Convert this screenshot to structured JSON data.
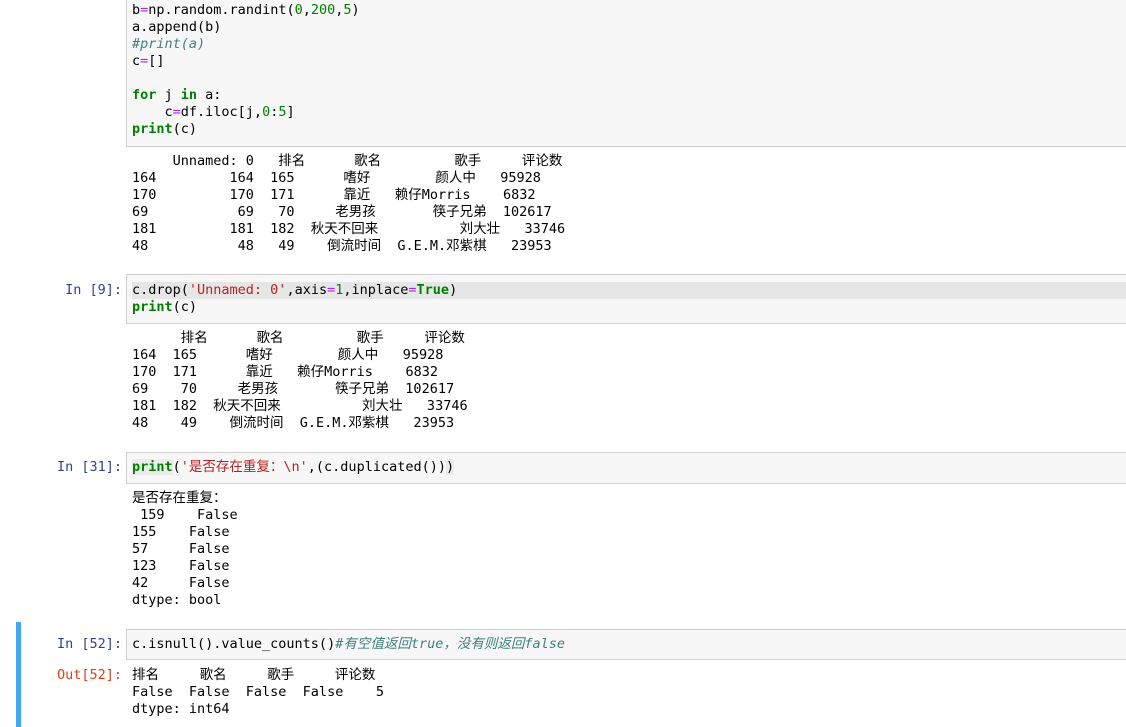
{
  "cells": [
    {
      "prompt": "",
      "code_lines": [
        "b=np.random.randint(0,200,5)",
        "a.append(b)",
        "#print(a)",
        "c=[]",
        "",
        "for j in a:",
        "    c=df.iloc[j,0:5]",
        "print(c)"
      ],
      "output": "     Unnamed: 0   排名      歌名         歌手     评论数\n164         164  165      嗜好        颜人中   95928\n170         170  171      靠近   赖仔Morris    6832\n69           69   70     老男孩       筷子兄弟  102617\n181         181  182  秋天不回来          刘大壮   33746\n48           48   49    倒流时间  G.E.M.邓紫棋   23953"
    },
    {
      "prompt": "In  [9]:",
      "code_lines": [
        "c.drop('Unnamed: 0',axis=1,inplace=True)",
        "print(c)"
      ],
      "output": "      排名      歌名         歌手     评论数\n164  165      嗜好        颜人中   95928\n170  171      靠近   赖仔Morris    6832\n69    70     老男孩       筷子兄弟  102617\n181  182  秋天不回来          刘大壮   33746\n48    49    倒流时间  G.E.M.邓紫棋   23953"
    },
    {
      "prompt": "In  [31]:",
      "code_lines": [
        "print('是否存在重复：\\n',(c.duplicated()))"
      ],
      "output": "是否存在重复：\n 159    False\n155    False\n57     False\n123    False\n42     False\ndtype: bool"
    },
    {
      "prompt": "In  [52]:",
      "out_prompt": "Out[52]:",
      "code_lines": [
        "c.isnull().value_counts()#有空值返回true，没有则返回false"
      ],
      "output": "排名     歌名     歌手     评论数\nFalse  False  False  False    5\ndtype: int64"
    }
  ],
  "colors": {
    "in_prompt": "#303f9f",
    "out_prompt": "#d84315",
    "selected_cell_bar": "#42a5f5",
    "input_background": "#f7f7f7"
  }
}
